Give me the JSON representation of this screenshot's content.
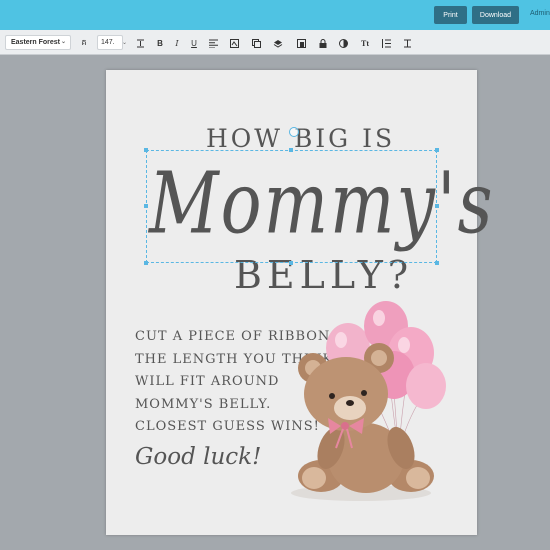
{
  "header": {
    "print_label": "Print",
    "download_label": "Download",
    "admin_label": "Admin"
  },
  "toolbar": {
    "font_family": "Eastern Forest",
    "font_size": "147."
  },
  "design": {
    "line1": "HOW BIG IS",
    "script_title": "Mommy's",
    "line3": "BELLY?",
    "instructions": [
      "CUT A PIECE OF RIBBON TO",
      "THE LENGTH YOU THINK",
      "WILL FIT AROUND",
      "MOMMY'S BELLY.",
      "CLOSEST GUESS WINS!"
    ],
    "sign_off": "Good luck!"
  },
  "colors": {
    "topbar": "#4fc3e3",
    "button": "#2f6f86",
    "selection": "#5ab7e3",
    "text": "#555555",
    "balloon": "#f2a9c4",
    "bear": "#b98e6e"
  }
}
